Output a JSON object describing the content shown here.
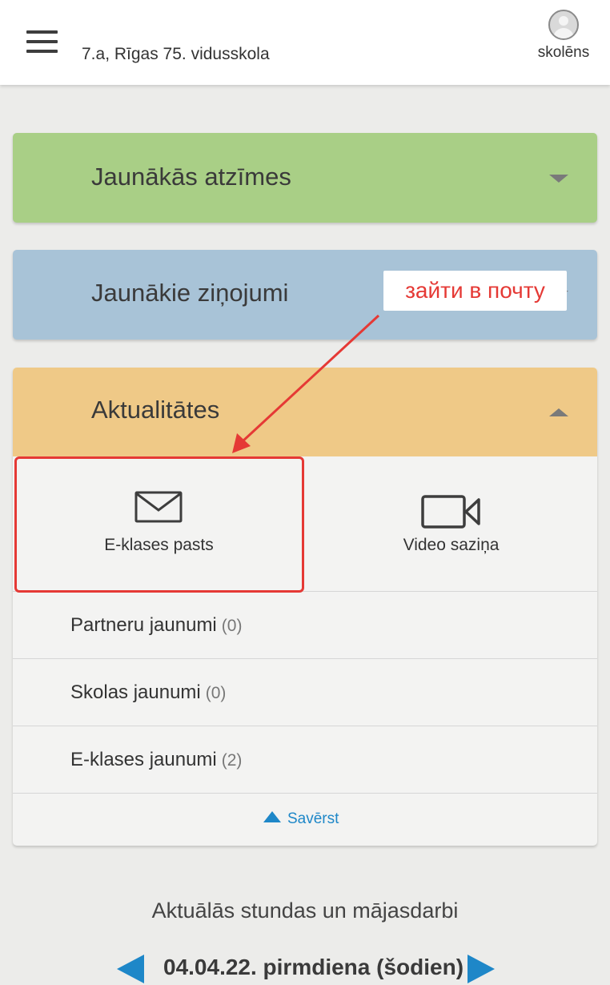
{
  "header": {
    "class_school": "7.a, Rīgas 75. vidusskola",
    "profile_label": "skolēns",
    "menu_icon": "hamburger-menu-icon",
    "profile_icon": "user-avatar-icon"
  },
  "panels": {
    "latest_grades": {
      "title": "Jaunākās atzīmes",
      "color": "#a9cf86",
      "expanded": false
    },
    "latest_messages": {
      "title": "Jaunākie ziņojumi",
      "color": "#a8c3d7",
      "expanded": false
    },
    "news": {
      "title": "Aktualitātes",
      "color": "#efc987",
      "expanded": true,
      "tiles": [
        {
          "label": "E-klases pasts",
          "icon": "envelope-icon"
        },
        {
          "label": "Video saziņa",
          "icon": "video-camera-icon"
        }
      ],
      "rows": [
        {
          "label": "Partneru jaunumi",
          "count": "(0)"
        },
        {
          "label": "Skolas jaunumi",
          "count": "(0)"
        },
        {
          "label": "E-klases jaunumi",
          "count": "(2)"
        }
      ],
      "collapse_label": "Savērst"
    }
  },
  "annotation": {
    "text": "зайти в почту",
    "color": "#e53935"
  },
  "lessons": {
    "title": "Aktuālās stundas un mājasdarbi",
    "date": "04.04.22. pirmdiena (šodien)",
    "accent": "#1e87c8"
  }
}
